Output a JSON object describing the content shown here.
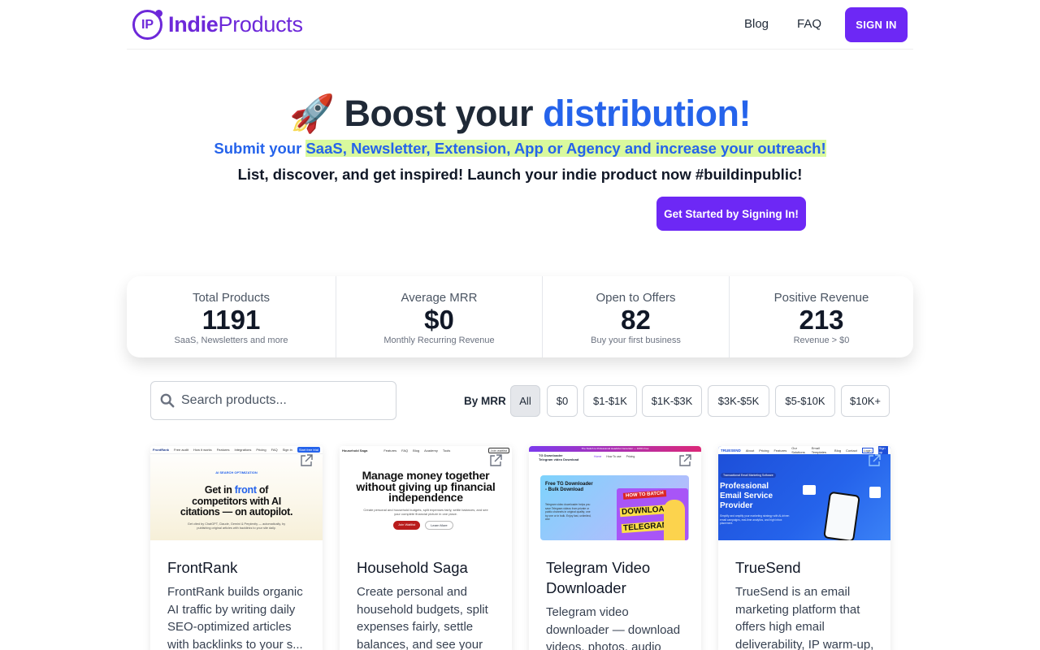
{
  "header": {
    "logo_initials": "IP",
    "logo_bold": "Indie",
    "logo_rest": "Products",
    "nav": {
      "blog": "Blog",
      "faq": "FAQ"
    },
    "sign_in": "SIGN IN"
  },
  "hero": {
    "emoji": "🚀",
    "title_plain": "Boost your",
    "title_accent": "distribution!",
    "subtitle_lead": "Submit your",
    "subtitle_highlight": "SaaS, Newsletter, Extension, App or Agency and increase your outreach!",
    "tagline": "List, discover, and get inspired! Launch your indie product now #buildinpublic!",
    "cta": "Get Started by Signing In!"
  },
  "stats": [
    {
      "title": "Total Products",
      "value": "1191",
      "desc": "SaaS, Newsletters and more"
    },
    {
      "title": "Average MRR",
      "value": "$0",
      "desc": "Monthly Recurring Revenue"
    },
    {
      "title": "Open to Offers",
      "value": "82",
      "desc": "Buy your first business"
    },
    {
      "title": "Positive Revenue",
      "value": "213",
      "desc": "Revenue > $0"
    }
  ],
  "search": {
    "placeholder": "Search products..."
  },
  "filters": {
    "label": "By MRR",
    "options": [
      "All",
      "$0",
      "$1-$1K",
      "$1K-$3K",
      "$3K-$5K",
      "$5-$10K",
      "$10K+"
    ],
    "selected": "All"
  },
  "products": [
    {
      "name": "FrontRank",
      "description": "FrontRank builds organic AI traffic by writing daily SEO-optimized articles with backlinks to your s...",
      "thumb": {
        "brand": "FrontRank",
        "nav": [
          "Free audit",
          "How it works",
          "Features",
          "Integrations",
          "Pricing",
          "FAQ",
          "Sign in"
        ],
        "button": "Start free trial",
        "eyebrow": "AI SEARCH OPTIMIZATION",
        "headline_1": "Get in",
        "headline_accent": "front",
        "headline_2": "of",
        "headline_3": "competitors with AI",
        "headline_4": "citations — on autopilot.",
        "body": "Get cited by ChatGPT, Claude, Gemini & Perplexity — automatically, by publishing original articles with backlinks to your site daily."
      }
    },
    {
      "name": "Household Saga",
      "description": "Create personal and household budgets, split expenses fairly, settle balances, and see your",
      "thumb": {
        "brand": "Household Saga",
        "nav": [
          "Features",
          "FAQ",
          "Blog",
          "Academy",
          "Tools"
        ],
        "button": "Join waitlist",
        "headline": "Manage money together without giving up financial independence",
        "body": "Create personal and household budgets, split expenses fairly, settle balances, and see your complete financial picture in one place.",
        "primary": "Join Waitlist",
        "secondary": "Learn More"
      }
    },
    {
      "name": "Telegram Video Downloader",
      "description": "Telegram video downloader — download videos, photos, audio",
      "thumb": {
        "banner": "The Switch to Professional Headshot Generator — 100% Free",
        "brand_1": "TG Downloader",
        "brand_2": "Telegram video Download",
        "nav": [
          "Home",
          "How To use",
          "Pricing"
        ],
        "panel_title": "Free TG Downloader - Bulk Download",
        "panel_body": "Telegram video downloader helps you save Telegram videos from private or public channels in original quality; one by one or in bulk. Enjoy fast, unlimited, and",
        "badge": "HOW TO BATCH",
        "overlay_1": "DOWNLOAD",
        "overlay_2": "TELEGRAM"
      }
    },
    {
      "name": "TrueSend",
      "description": "TrueSend is an email marketing platform that offers high email deliverability, IP warm-up,",
      "thumb": {
        "brand": "TRUESEND",
        "nav": [
          "About",
          "Pricing",
          "Features",
          "Our Solutions",
          "Email Templates",
          "Blog",
          "Contact"
        ],
        "login": "Login",
        "signup": "Sign up",
        "tag": "Transactional Email Marketing Software",
        "headline": "Professional Email Service Provider",
        "body": "Simplify and amplify your marketing strategy with AI-driven email campaigns, real-time analytics, and high inbox placement."
      }
    }
  ],
  "colors": {
    "brand": "#6d28d9",
    "primary_button": "#6d28f5",
    "accent_blue": "#2563eb",
    "highlight": "#d9f99d"
  }
}
